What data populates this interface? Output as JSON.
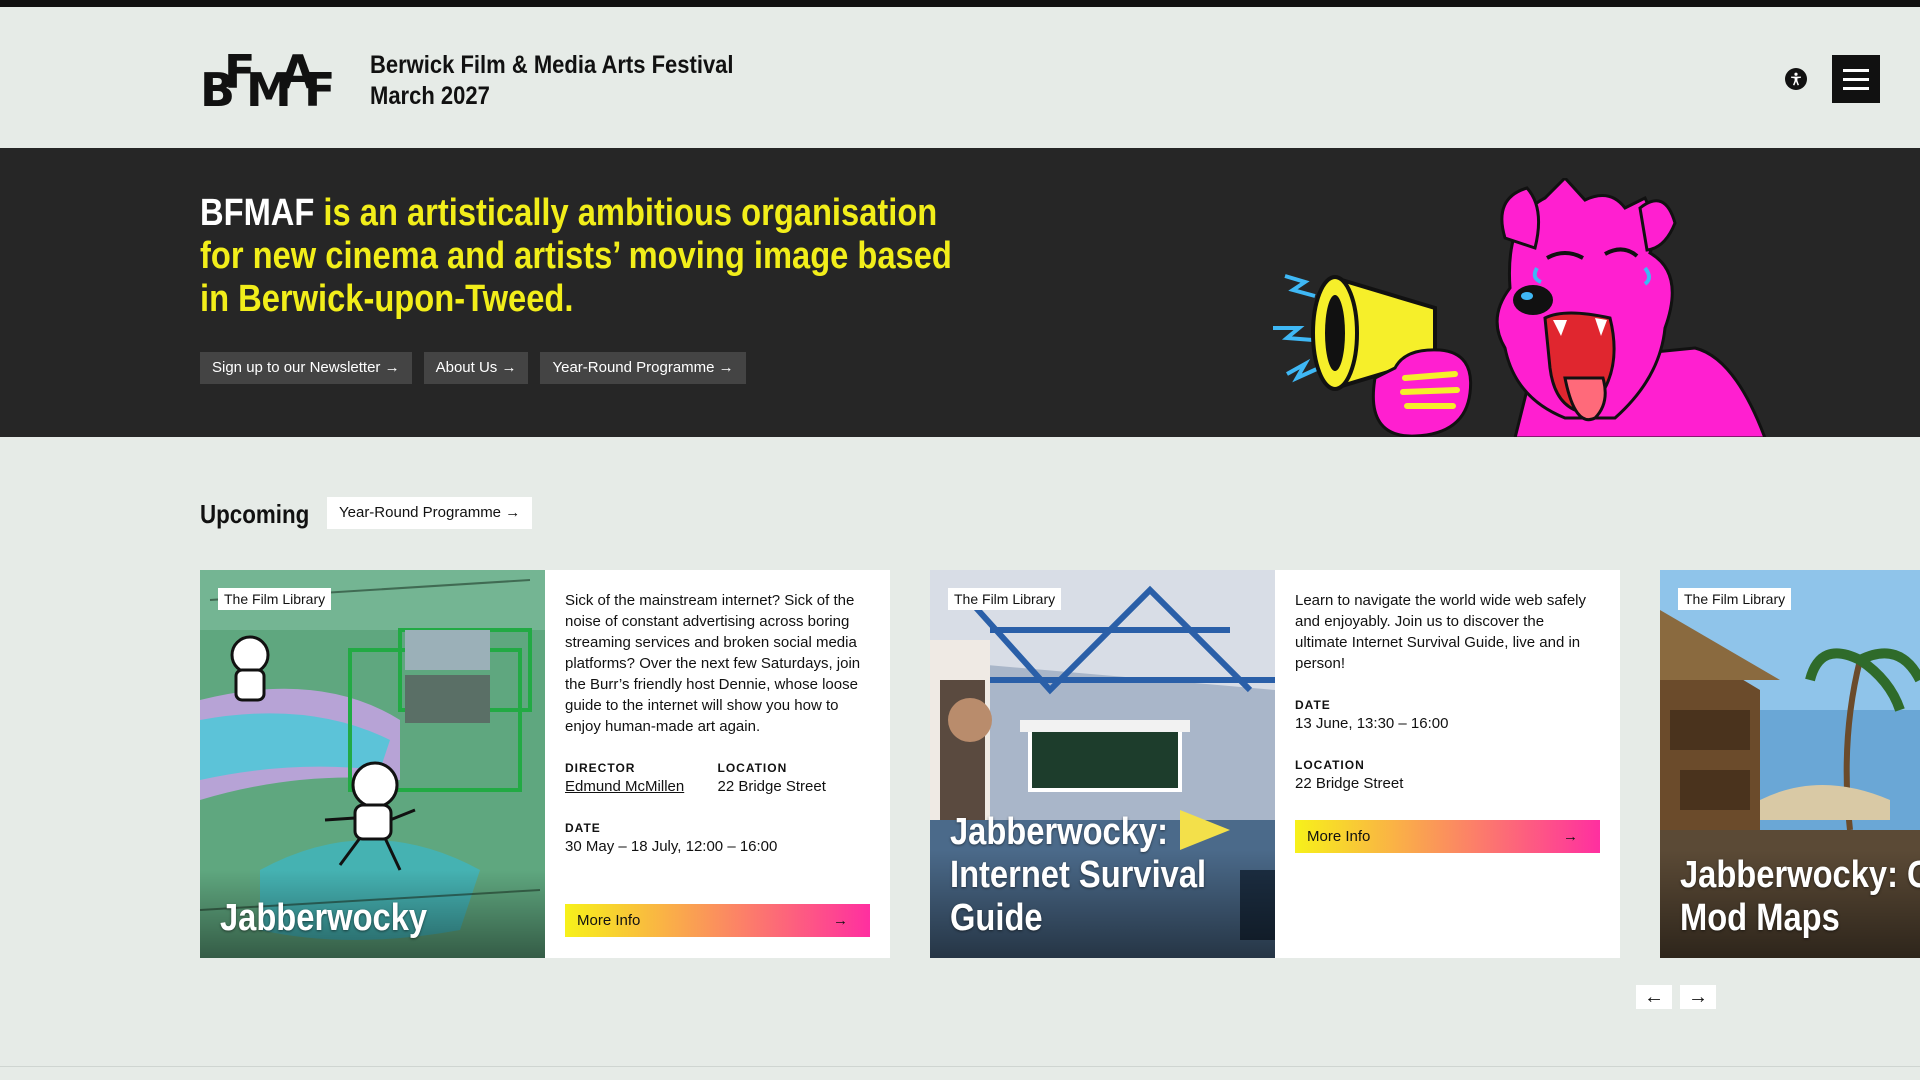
{
  "header": {
    "logo_letters": [
      "B",
      "F",
      "M",
      "A",
      "F"
    ],
    "title_line1": "Berwick Film & Media Arts Festival",
    "title_line2": "March 2027",
    "accessibility_icon": "accessibility-icon",
    "menu_icon": "hamburger-menu-icon"
  },
  "hero": {
    "brand": "BFMAF",
    "tagline": " is an artistically ambitious organisation for new cinema and artists’ moving image based in Berwick-upon-Tweed.",
    "buttons": [
      {
        "label": "Sign up to our Newsletter →"
      },
      {
        "label": "About Us →"
      },
      {
        "label": "Year-Round Programme →"
      }
    ],
    "colors": {
      "accent": "#f2ee1a",
      "background": "#262626",
      "mascot": "#ff1fd0"
    }
  },
  "upcoming": {
    "title": "Upcoming",
    "link_label": "Year-Round Programme →"
  },
  "cards": [
    {
      "tag": "The Film Library",
      "title": "Jabberwocky",
      "description": "Sick of the mainstream internet? Sick of the noise of constant advertising across boring streaming services and broken social media platforms? Over the next few Saturdays, join the Burr’s friendly host Dennie, whose loose guide to the internet will show you how to enjoy human-made art again.",
      "director_label": "DIRECTOR",
      "director": "Edmund McMillen",
      "location_label": "LOCATION",
      "location": "22 Bridge Street",
      "date_label": "DATE",
      "date": "30 May – 18 July, 12:00 – 16:00",
      "more_label": "More Info",
      "arrow": "→"
    },
    {
      "tag": "The Film Library",
      "title": "Jabberwocky: Internet Survival Guide",
      "description": "Learn to navigate the world wide web safely and enjoyably. Join us to discover the ultimate Internet Survival Guide, live and in person!",
      "date_label": "DATE",
      "date": "13 June, 13:30 – 16:00",
      "location_label": "LOCATION",
      "location": "22 Bridge Street",
      "more_label": "More Info",
      "arrow": "→"
    },
    {
      "tag": "The Film Library",
      "title": "Jabberwocky: G Mod Maps"
    }
  ],
  "carousel": {
    "prev": "←",
    "next": "→"
  }
}
